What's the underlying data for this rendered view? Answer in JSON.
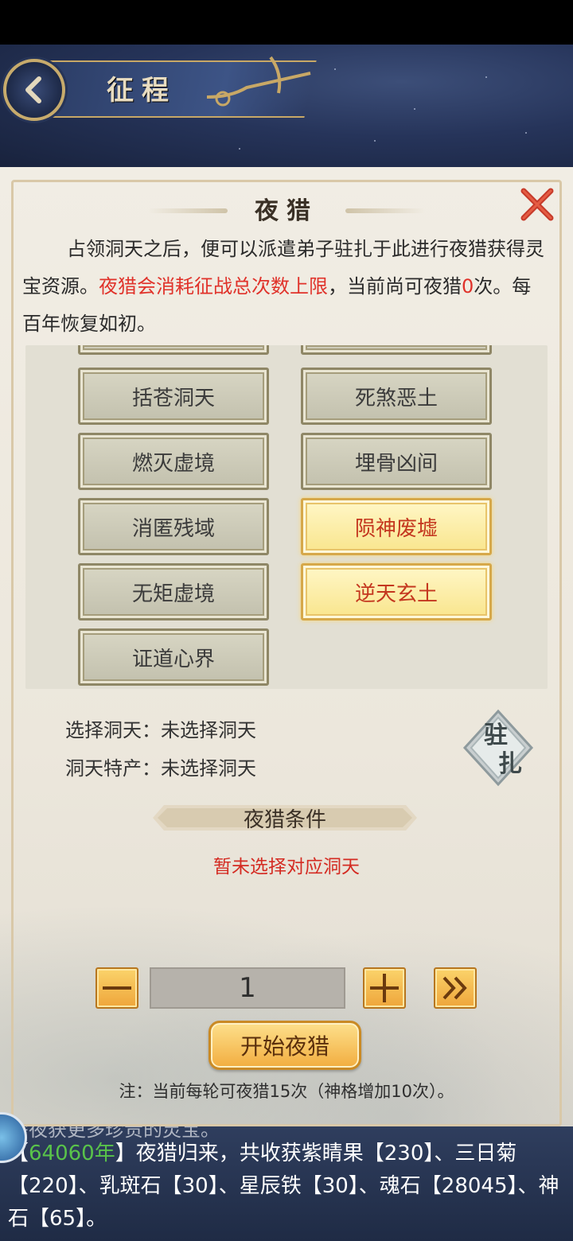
{
  "header": {
    "title": "征程"
  },
  "dialog": {
    "title": "夜猎",
    "desc_part1": "占领洞天之后，便可以派遣弟子驻扎于此进行夜猎获得灵宝资源。",
    "desc_red1": "夜猎会消耗征战总次数上限",
    "desc_part2": "，当前尚可夜猎",
    "desc_count": "0",
    "desc_part3": "次。每百年恢复如初。"
  },
  "caves": [
    {
      "label": "括苍洞天",
      "highlighted": false
    },
    {
      "label": "死煞恶土",
      "highlighted": false
    },
    {
      "label": "燃灭虚境",
      "highlighted": false
    },
    {
      "label": "埋骨凶间",
      "highlighted": false
    },
    {
      "label": "消匿残域",
      "highlighted": false
    },
    {
      "label": "陨神废墟",
      "highlighted": true
    },
    {
      "label": "无矩虚境",
      "highlighted": false
    },
    {
      "label": "逆天玄土",
      "highlighted": true
    },
    {
      "label": "证道心界",
      "highlighted": false
    }
  ],
  "selection": {
    "cave_label": "选择洞天：",
    "cave_value": "未选择洞天",
    "product_label": "洞天特产：",
    "product_value": "未选择洞天",
    "station_label_1": "驻",
    "station_label_2": "扎"
  },
  "conditions": {
    "title": "夜猎条件",
    "note": "暂未选择对应洞天"
  },
  "quantity": {
    "minus_label": "—",
    "value": "1",
    "plus_label": "+",
    "max_label": "»"
  },
  "start_button": "开始夜猎",
  "footnote": "注：当前每轮可夜猎15次（神格增加10次）。",
  "log": {
    "cut_line": "需夜获更多珍贵的灵宝。",
    "bracket_open": "【",
    "year": "64060年",
    "text_1": "】夜猎归来，共收获紫睛果【230】、三日菊【220】、乳斑石【30】、星辰铁【30】、魂石【28045】、神石【65】。"
  }
}
